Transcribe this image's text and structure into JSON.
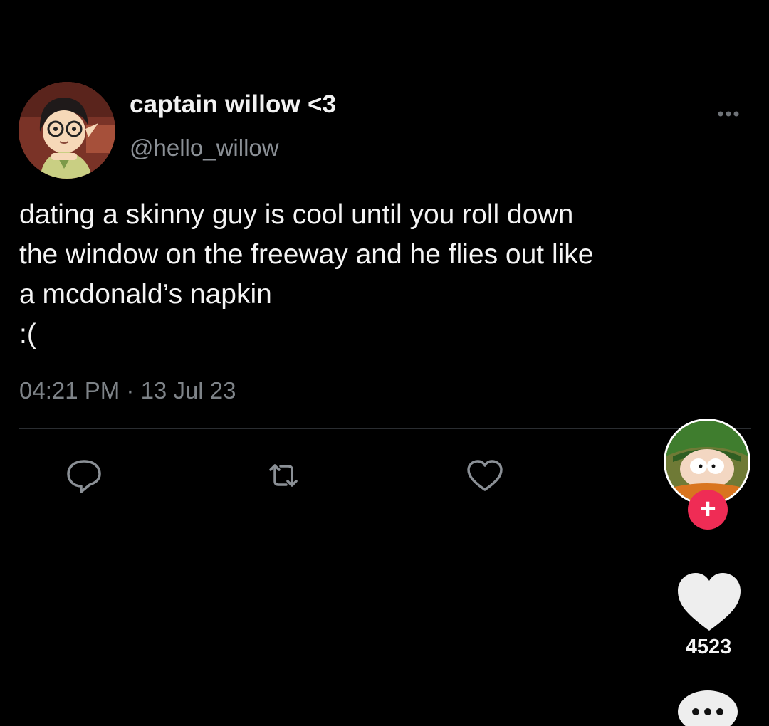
{
  "tweet": {
    "display_name": "captain willow <3",
    "handle": "@hello_willow",
    "text": "dating a skinny guy is cool until you roll down\nthe window on the freeway and he flies out like\na mcdonald’s napkin\n :(",
    "timestamp": "04:21 PM · 13 Jul 23",
    "icons": {
      "more": "more-horizontal-icon",
      "reply": "reply-bubble-icon",
      "retweet": "retweet-icon",
      "like": "heart-outline-icon"
    }
  },
  "overlay": {
    "follow_label": "+",
    "like_count": "4523",
    "icons": {
      "like": "heart-filled-icon",
      "comments": "comment-bubble-icon"
    }
  },
  "colors": {
    "background": "#000000",
    "text_primary": "#f4f4f4",
    "text_secondary": "#8b9096",
    "follow_accent": "#ef2c55"
  }
}
